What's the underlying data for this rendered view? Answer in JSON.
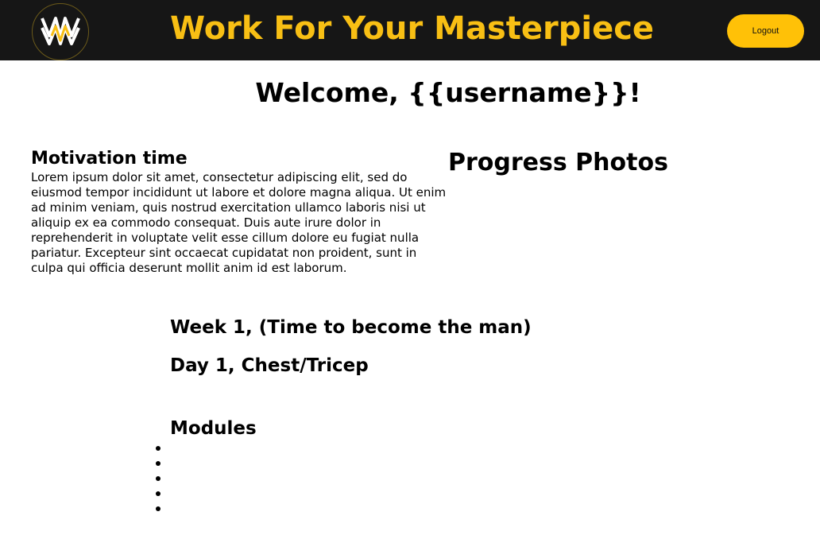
{
  "header": {
    "brand_title": "Work For Your Masterpiece",
    "logout_label": "Logout",
    "logo_icon": "wm-zigzag-logo-icon",
    "colors": {
      "bar_background": "#161616",
      "brand_yellow": "#f8bf14",
      "button_yellow": "#ffc107"
    }
  },
  "welcome": {
    "text": "Welcome, {{username}}!"
  },
  "motivation": {
    "heading": "Motivation time",
    "body": "Lorem ipsum dolor sit amet, consectetur adipiscing elit, sed do eiusmod tempor incididunt ut labore et dolore magna aliqua. Ut enim ad minim veniam, quis nostrud exercitation ullamco laboris nisi ut aliquip ex ea commodo consequat. Duis aute irure dolor in reprehenderit in voluptate velit esse cillum dolore eu fugiat nulla pariatur. Excepteur sint occaecat cupidatat non proident, sunt in culpa qui officia deserunt mollit anim id est laborum."
  },
  "progress": {
    "heading": "Progress Photos"
  },
  "program": {
    "week_title": "Week 1, (Time to become the man)",
    "day_title": "Day 1, Chest/Tricep",
    "modules_heading": "Modules",
    "modules": [
      "",
      "",
      "",
      "",
      ""
    ]
  }
}
